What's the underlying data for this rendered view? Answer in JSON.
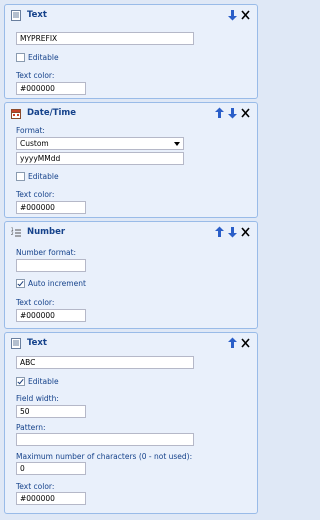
{
  "panels": [
    {
      "title": "Text",
      "icon": "text-document-icon",
      "fields": {
        "value": "MYPREFIX",
        "editable_label": "Editable",
        "editable": false,
        "text_color_label": "Text color:",
        "text_color": "#000000"
      }
    },
    {
      "title": "Date/Time",
      "icon": "calendar-icon",
      "fields": {
        "format_label": "Format:",
        "format_selected": "Custom",
        "pattern_value": "yyyyMMdd",
        "editable_label": "Editable",
        "editable": false,
        "text_color_label": "Text color:",
        "text_color": "#000000"
      }
    },
    {
      "title": "Number",
      "icon": "numbered-list-icon",
      "fields": {
        "number_format_label": "Number format:",
        "number_format": "",
        "auto_increment_label": "Auto increment",
        "auto_increment": true,
        "text_color_label": "Text color:",
        "text_color": "#000000"
      }
    },
    {
      "title": "Text",
      "icon": "text-document-icon",
      "fields": {
        "value": "ABC",
        "editable_label": "Editable",
        "editable": true,
        "field_width_label": "Field width:",
        "field_width": "50",
        "pattern_label": "Pattern:",
        "pattern": "",
        "max_chars_label": "Maximum number of characters (0 - not used):",
        "max_chars": "0",
        "text_color_label": "Text color:",
        "text_color": "#000000"
      }
    }
  ]
}
